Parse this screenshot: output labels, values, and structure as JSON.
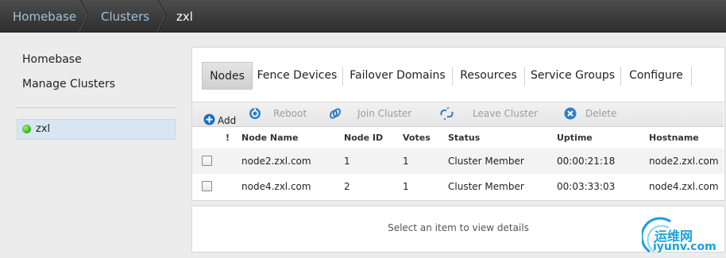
{
  "breadcrumb": {
    "items": [
      "Homebase",
      "Clusters",
      "zxl"
    ]
  },
  "sidebar": {
    "links": [
      "Homebase",
      "Manage Clusters"
    ],
    "clusters": [
      {
        "name": "zxl",
        "status_color": "#2fb512"
      }
    ]
  },
  "tabs": {
    "items": [
      "Nodes",
      "Fence Devices",
      "Failover Domains",
      "Resources",
      "Service Groups",
      "Configure"
    ],
    "active": "Nodes"
  },
  "toolbar": {
    "add": "Add",
    "reboot": "Reboot",
    "join": "Join Cluster",
    "leave": "Leave Cluster",
    "delete": "Delete"
  },
  "table": {
    "columns": [
      "!",
      "Node Name",
      "Node ID",
      "Votes",
      "Status",
      "Uptime",
      "Hostname"
    ],
    "rows": [
      {
        "name": "node2.zxl.com",
        "id": "1",
        "votes": "1",
        "status": "Cluster Member",
        "uptime": "00:00:21:18",
        "hostname": "node2.zxl.com"
      },
      {
        "name": "node4.zxl.com",
        "id": "2",
        "votes": "1",
        "status": "Cluster Member",
        "uptime": "00:03:33:03",
        "hostname": "node4.zxl.com"
      }
    ]
  },
  "details": {
    "empty_text": "Select an item to view details"
  },
  "watermark": {
    "text_cn": "运维网",
    "text_en": "iyunv.com"
  },
  "colors": {
    "accent": "#9ec3df",
    "selected_bg": "#d8e6f2",
    "status_green": "#2fb512",
    "watermark": "#1aa0e0"
  }
}
